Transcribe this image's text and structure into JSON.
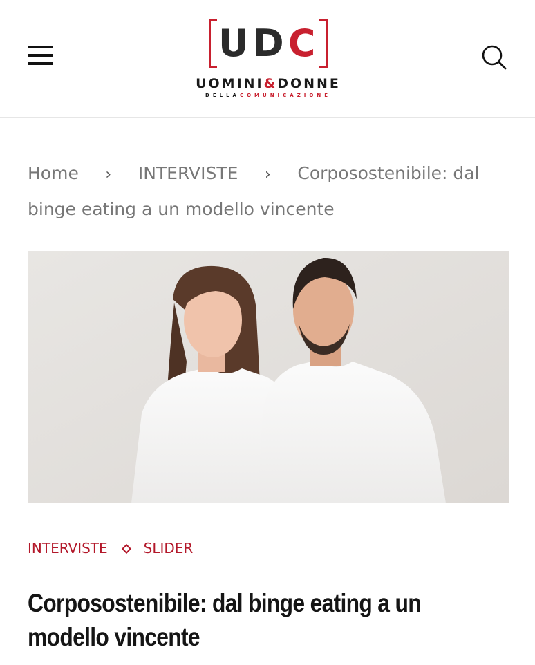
{
  "header": {
    "logo": {
      "mark_left": "UD",
      "mark_right": "C",
      "subtitle_left": "UOMINI",
      "subtitle_amp": "&",
      "subtitle_right": "DONNE",
      "tagline_left": "DELLA",
      "tagline_right": "COMUNICAZIONE"
    },
    "menu_icon": "hamburger-icon",
    "search_icon": "search-icon"
  },
  "breadcrumb": {
    "items": [
      "Home",
      "INTERVISTE",
      "Corposostenibile: dal binge eating a un modello vincente"
    ],
    "separator": "›"
  },
  "article": {
    "image_alt": "Corposostenibile: dal binge eating a un modello vincente",
    "categories": [
      "INTERVISTE",
      "SLIDER"
    ],
    "title": "Corposostenibile: dal binge eating a un modello vincente"
  },
  "colors": {
    "accent": "#c8202f",
    "category": "#b3182a",
    "text": "#151515",
    "breadcrumb": "#777777",
    "divider": "#e6e6e6"
  }
}
